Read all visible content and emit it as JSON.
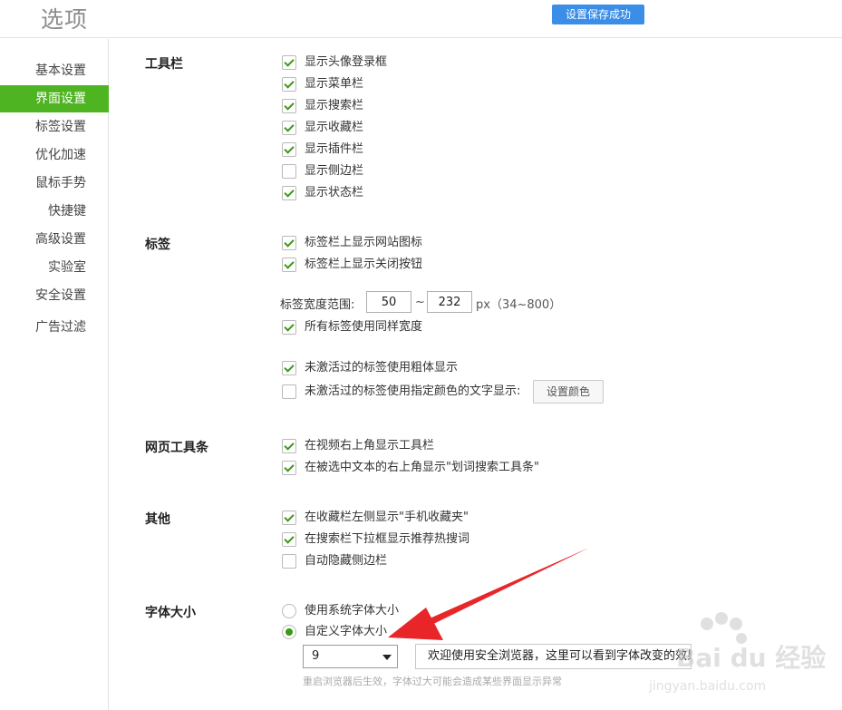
{
  "header": {
    "title": "选项",
    "toast": "设置保存成功"
  },
  "sidebar": {
    "items": [
      {
        "label": "基本设置"
      },
      {
        "label": "界面设置",
        "active": true
      },
      {
        "label": "标签设置"
      },
      {
        "label": "优化加速"
      },
      {
        "label": "鼠标手势"
      },
      {
        "label": "快捷键"
      },
      {
        "label": "高级设置"
      },
      {
        "label": "实验室"
      },
      {
        "label": "安全设置"
      },
      {
        "label": "广告过滤"
      }
    ]
  },
  "toolbar_section": {
    "title": "工具栏",
    "options": [
      {
        "label": "显示头像登录框",
        "checked": true
      },
      {
        "label": "显示菜单栏",
        "checked": true
      },
      {
        "label": "显示搜索栏",
        "checked": true
      },
      {
        "label": "显示收藏栏",
        "checked": true
      },
      {
        "label": "显示插件栏",
        "checked": true
      },
      {
        "label": "显示侧边栏",
        "checked": false
      },
      {
        "label": "显示状态栏",
        "checked": true
      }
    ]
  },
  "tabs_section": {
    "title": "标签",
    "options": [
      {
        "label": "标签栏上显示网站图标",
        "checked": true
      },
      {
        "label": "标签栏上显示关闭按钮",
        "checked": true
      }
    ],
    "width_range": {
      "label": "标签宽度范围:",
      "min": "50",
      "separator": "~",
      "max": "232",
      "unit": "px（34~800）"
    },
    "same_width": {
      "label": "所有标签使用同样宽度",
      "checked": true
    },
    "inactive_bold": {
      "label": "未激活过的标签使用粗体显示",
      "checked": true
    },
    "inactive_color": {
      "label": "未激活过的标签使用指定颜色的文字显示:",
      "checked": false
    },
    "set_color_button": "设置颜色"
  },
  "webbar_section": {
    "title": "网页工具条",
    "options": [
      {
        "label": "在视频右上角显示工具栏",
        "checked": true
      },
      {
        "label": "在被选中文本的右上角显示\"划词搜索工具条\"",
        "checked": true
      }
    ]
  },
  "other_section": {
    "title": "其他",
    "options": [
      {
        "label": "在收藏栏左侧显示\"手机收藏夹\"",
        "checked": true
      },
      {
        "label": "在搜索栏下拉框显示推荐热搜词",
        "checked": true
      },
      {
        "label": "自动隐藏侧边栏",
        "checked": false
      }
    ]
  },
  "font_section": {
    "title": "字体大小",
    "radios": [
      {
        "label": "使用系统字体大小",
        "selected": false
      },
      {
        "label": "自定义字体大小",
        "selected": true
      }
    ],
    "size_value": "9",
    "preview_text": "欢迎使用安全浏览器，这里可以看到字体改变的效果",
    "hint": "重启浏览器后生效，字体过大可能会造成某些界面显示异常"
  },
  "watermark": {
    "main": "Bai du 经验",
    "sub": "jingyan.baidu.com"
  },
  "colors": {
    "accent_green": "#4fb421",
    "toast_blue": "#3b8ee7",
    "arrow_red": "#e8262a"
  }
}
